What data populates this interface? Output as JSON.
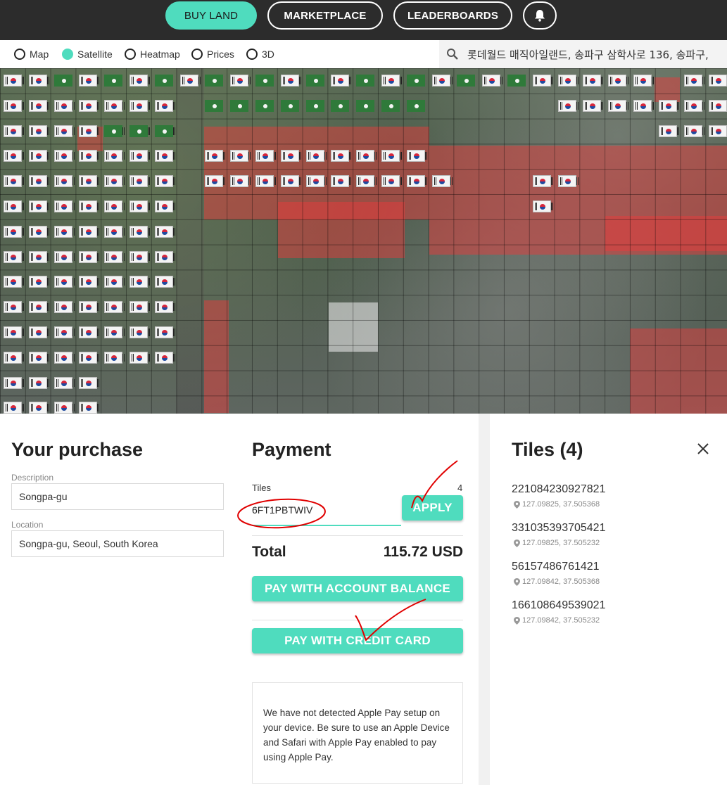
{
  "nav": {
    "buy_land": "BUY LAND",
    "marketplace": "MARKETPLACE",
    "leaderboards": "LEADERBOARDS"
  },
  "layers": {
    "map": "Map",
    "satellite": "Satellite",
    "heatmap": "Heatmap",
    "prices": "Prices",
    "three_d": "3D",
    "selected": "Satellite"
  },
  "search": {
    "value": "롯데월드 매직아일랜드, 송파구 삼학사로 136, 송파구,"
  },
  "purchase": {
    "title": "Your purchase",
    "description_label": "Description",
    "description_value": "Songpa-gu",
    "location_label": "Location",
    "location_value": "Songpa-gu, Seoul, South Korea"
  },
  "payment": {
    "title": "Payment",
    "tiles_label": "Tiles",
    "tiles_count": "4",
    "promo_value": "6FT1PBTWIV",
    "apply_label": "APPLY",
    "total_label": "Total",
    "total_value": "115.72 USD",
    "pay_balance_label": "PAY WITH ACCOUNT BALANCE",
    "pay_card_label": "PAY WITH CREDIT CARD",
    "apple_pay_notice": "We have not detected Apple Pay setup on your device. Be sure to use an Apple Device and Safari with Apple Pay enabled to pay using Apple Pay."
  },
  "tiles_panel": {
    "title": "Tiles (4)",
    "tiles": [
      {
        "id": "221084230927821",
        "coords": "127.09825, 37.505368"
      },
      {
        "id": "331035393705421",
        "coords": "127.09825, 37.505232"
      },
      {
        "id": "56157486761421",
        "coords": "127.09842, 37.505368"
      },
      {
        "id": "166108649539021",
        "coords": "127.09842, 37.505232"
      }
    ]
  },
  "colors": {
    "accent": "#4fdcbe",
    "topbar": "#2c2c2c",
    "owned_overlay": "#e63c3c",
    "annotation": "#e00000"
  },
  "icons": [
    "bell-icon",
    "search-icon",
    "close-icon",
    "location-pin-icon",
    "korea-flag-icon"
  ]
}
